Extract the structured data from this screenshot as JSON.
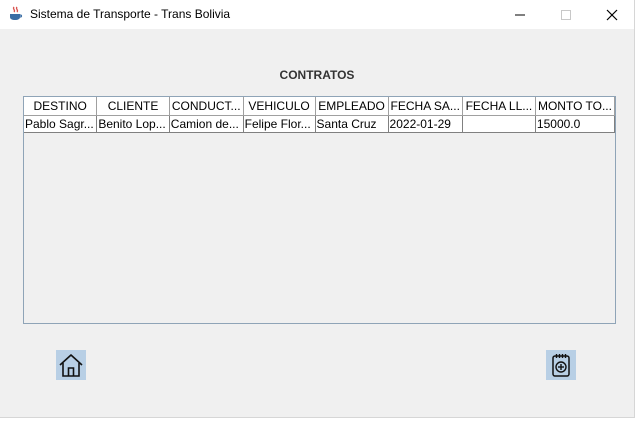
{
  "window": {
    "title": "Sistema de Transporte - Trans Bolivia",
    "icon": "java-app-icon"
  },
  "heading": "CONTRATOS",
  "table": {
    "columns": [
      "DESTINO",
      "CLIENTE",
      "CONDUCT...",
      "VEHICULO",
      "EMPLEADO",
      "FECHA SA...",
      "FECHA LL...",
      "MONTO TO..."
    ],
    "rows": [
      [
        "Pablo Sagr...",
        "Benito Lop...",
        "Camion de...",
        "Felipe Flor...",
        "Santa Cruz",
        "2022-01-29",
        "",
        "15000.0"
      ]
    ]
  },
  "buttons": {
    "home": {
      "icon": "home-icon"
    },
    "add_contract": {
      "icon": "add-document-icon"
    }
  },
  "colors": {
    "button_bg": "#b8cfe5",
    "table_border": "#8fa4b7"
  }
}
